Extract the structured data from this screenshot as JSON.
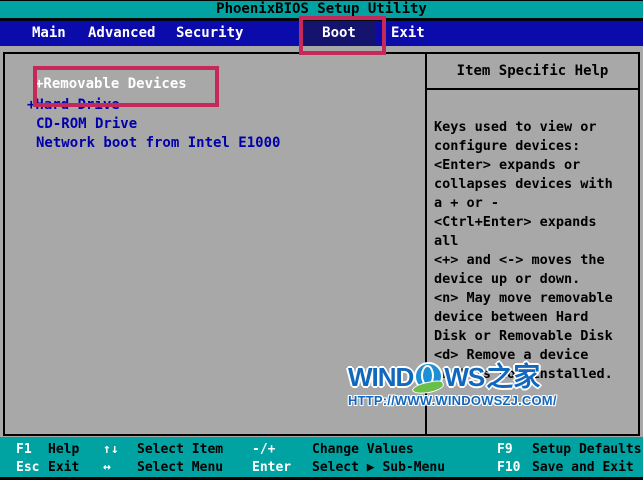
{
  "title": "PhoenixBIOS Setup Utility",
  "menu": {
    "items": [
      {
        "label": "Main",
        "selected": false
      },
      {
        "label": "Advanced",
        "selected": false
      },
      {
        "label": "Security",
        "selected": false
      },
      {
        "label": "Boot",
        "selected": true
      },
      {
        "label": "Exit",
        "selected": false
      }
    ]
  },
  "boot_list": {
    "items": [
      {
        "label": "+Removable Devices",
        "selected": true,
        "annotated": true
      },
      {
        "label": "+Hard Drive",
        "selected": false
      },
      {
        "label": "CD-ROM Drive",
        "selected": false
      },
      {
        "label": "Network boot from Intel E1000",
        "selected": false
      }
    ]
  },
  "help_panel": {
    "title": "Item Specific Help",
    "lines": [
      "Keys used to view or",
      "configure devices:",
      "<Enter> expands or",
      "collapses devices with",
      "a + or -",
      "<Ctrl+Enter> expands",
      "all",
      "<+> and <-> moves the",
      "device up or down.",
      "<n> May move removable",
      "device between Hard",
      "Disk or Removable Disk",
      "<d> Remove a device",
      "that is not installed."
    ]
  },
  "watermark": {
    "logo_wind": "WIND",
    "logo_ws": "WS",
    "logo_cjk": "之家",
    "url": "HTTP://WWW.WINDOWSZJ.COM/"
  },
  "footer": {
    "rows": [
      {
        "entries": [
          {
            "key": "F1",
            "label": "Help"
          },
          {
            "key": "↑↓",
            "label": "Select Item"
          },
          {
            "key": "-/+",
            "label": "Change Values"
          },
          {
            "key": "F9",
            "label": "Setup Defaults"
          }
        ]
      },
      {
        "entries": [
          {
            "key": "Esc",
            "label": "Exit"
          },
          {
            "key": "↔",
            "label": "Select Menu"
          },
          {
            "key": "Enter",
            "label": "Select ▶ Sub-Menu"
          },
          {
            "key": "F10",
            "label": "Save and Exit"
          }
        ]
      }
    ]
  },
  "colors": {
    "teal_bar": "#00a2a2",
    "menu_blue": "#0b0bac",
    "selected_tab_navy": "#14146e",
    "panel_grey": "#a8a8a8",
    "item_text_blue": "#0000a8",
    "annotation_red": "#c5295a",
    "watermark_blue": "#1268bd",
    "watermark_green": "#6abf4b"
  }
}
